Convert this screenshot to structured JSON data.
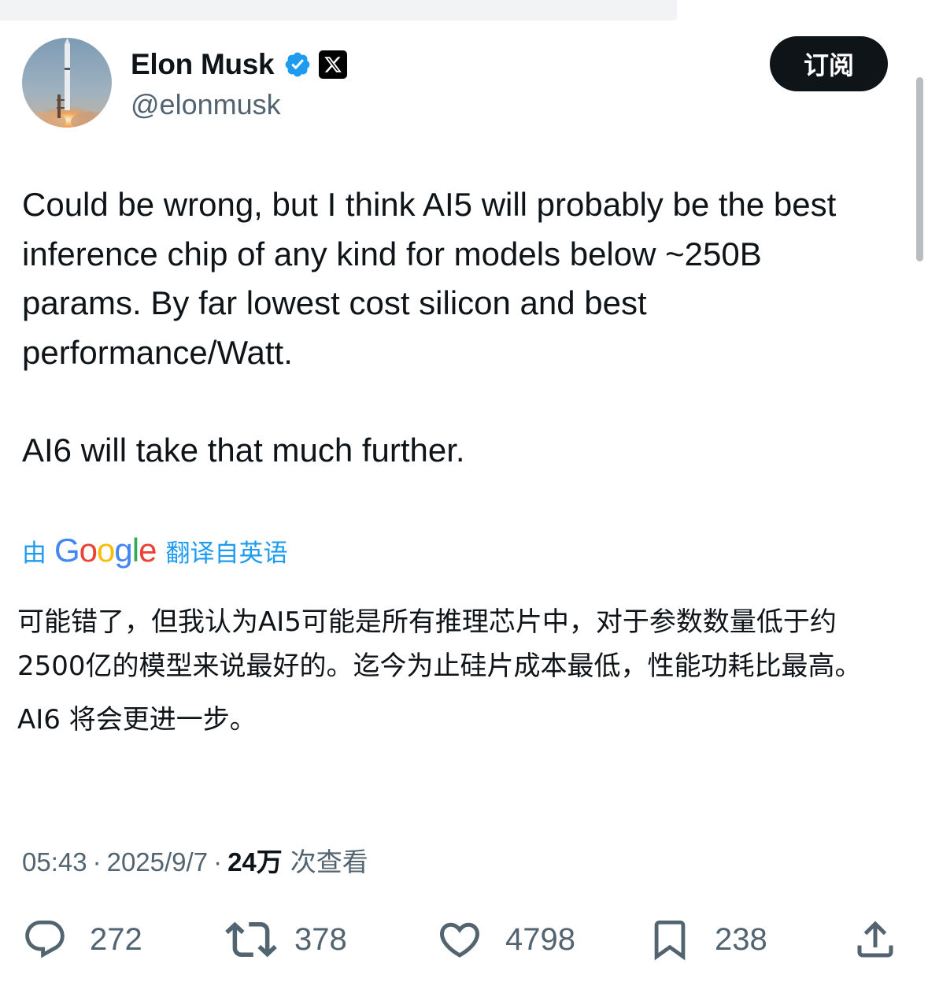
{
  "author": {
    "display_name": "Elon Musk",
    "handle": "@elonmusk",
    "verified": true
  },
  "subscribe_label": "订阅",
  "tweet": {
    "paragraphs": [
      "Could be wrong, but I think AI5 will probably be the best inference chip of any kind for models below ~250B params. By far lowest cost silicon and best performance/Watt.",
      "AI6 will take that much further."
    ]
  },
  "translation": {
    "prefix": "由",
    "provider": "Google",
    "suffix": "翻译自英语",
    "paragraphs": [
      "可能错了，但我认为AI5可能是所有推理芯片中，对于参数数量低于约2500亿的模型来说最好的。迄今为止硅片成本最低，性能功耗比最高。",
      "AI6 将会更进一步。"
    ]
  },
  "meta": {
    "time": "05:43",
    "separator": "·",
    "date": "2025/9/7",
    "views_count": "24万",
    "views_label": "次查看"
  },
  "actions": {
    "replies": "272",
    "reposts": "378",
    "likes": "4798",
    "bookmarks": "238"
  },
  "colors": {
    "accent": "#1d9bf0",
    "text": "#0f1419",
    "secondary": "#536471",
    "google_blue": "#4285f4",
    "google_red": "#ea4335",
    "google_yellow": "#fbbc05",
    "google_green": "#34a853"
  },
  "icons": {
    "avatar": "rocket-launch-photo",
    "verified": "verified-badge-icon",
    "platform": "x-logo-icon",
    "reply": "reply-icon",
    "repost": "repost-icon",
    "like": "heart-icon",
    "bookmark": "bookmark-icon",
    "share": "share-icon"
  }
}
